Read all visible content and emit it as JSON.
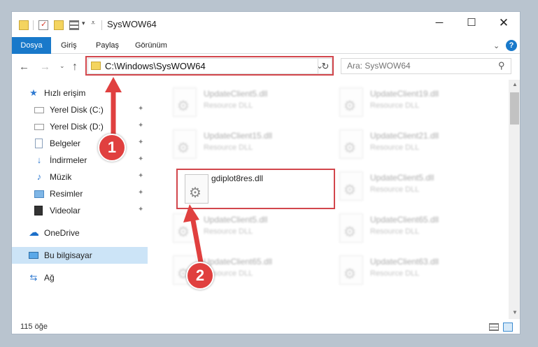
{
  "window": {
    "title": "SysWOW64",
    "min_glyph": "─",
    "max_glyph": "☐",
    "close_glyph": "✕"
  },
  "ribbon": {
    "tabs": [
      "Dosya",
      "Giriş",
      "Paylaş",
      "Görünüm"
    ],
    "expand_glyph": "⌄",
    "help_glyph": "?"
  },
  "nav": {
    "back_glyph": "←",
    "forward_glyph": "→",
    "recent_glyph": "⌄",
    "up_glyph": "↑",
    "address": "C:\\Windows\\SysWOW64",
    "dropdown_glyph": "⌄",
    "refresh_glyph": "↻",
    "search_placeholder": "Ara: SysWOW64",
    "search_glyph": "⚲"
  },
  "sidebar": {
    "items": [
      {
        "label": "Hızlı erişim",
        "icon": "star-icon"
      },
      {
        "label": "Yerel Disk (C:)",
        "icon": "drive-icon",
        "pinned": true
      },
      {
        "label": "Yerel Disk (D:)",
        "icon": "drive-icon",
        "pinned": true
      },
      {
        "label": "Belgeler",
        "icon": "document-icon",
        "pinned": true
      },
      {
        "label": "İndirmeler",
        "icon": "download-icon",
        "pinned": true
      },
      {
        "label": "Müzik",
        "icon": "music-icon",
        "pinned": true
      },
      {
        "label": "Resimler",
        "icon": "picture-icon",
        "pinned": true
      },
      {
        "label": "Videolar",
        "icon": "video-icon",
        "pinned": true
      },
      {
        "label": "OneDrive",
        "icon": "cloud-icon"
      },
      {
        "label": "Bu bilgisayar",
        "icon": "computer-icon",
        "selected": true
      },
      {
        "label": "Ağ",
        "icon": "network-icon"
      }
    ],
    "pin_glyph": "📌"
  },
  "files": [
    {
      "name": "UpdateClient5.dll",
      "type": "Resource DLL"
    },
    {
      "name": "UpdateClient19.dll",
      "type": "Resource DLL"
    },
    {
      "name": "UpdateClient15.dll",
      "type": "Resource DLL"
    },
    {
      "name": "UpdateClient21.dll",
      "type": "Resource DLL"
    },
    {
      "name": "gdiplot8res.dll",
      "type": ""
    },
    {
      "name": "UpdateClient5.dll",
      "type": "Resource DLL"
    },
    {
      "name": "UpdateClient5.dll",
      "type": "Resource DLL"
    },
    {
      "name": "UpdateClient65.dll",
      "type": "Resource DLL"
    },
    {
      "name": "UpdateClient65.dll",
      "type": "Resource DLL"
    },
    {
      "name": "UpdateClient63.dll",
      "type": "Resource DLL"
    }
  ],
  "status": {
    "item_count": "115 öğe"
  },
  "annotations": {
    "step1": "1",
    "step2": "2",
    "color": "#e0403f"
  },
  "colors": {
    "accent": "#1979ca",
    "highlight_border": "#d2464c",
    "selection": "#cce4f7"
  }
}
